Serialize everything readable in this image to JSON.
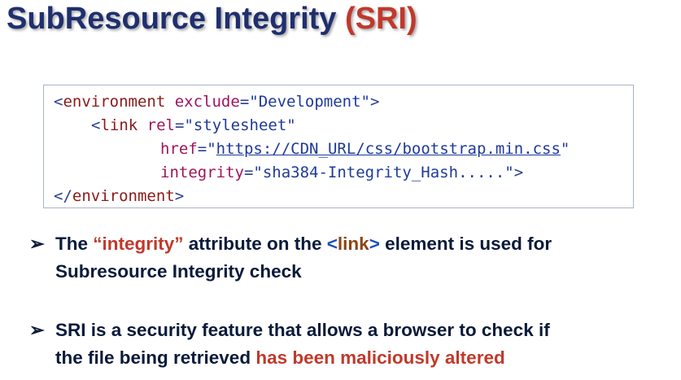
{
  "title": {
    "main": "SubResource Integrity ",
    "accent": "(SRI)"
  },
  "code": {
    "line1": {
      "open": "<",
      "tag": "environment",
      "attr": " exclude",
      "eq": "=",
      "value": "\"Development\"",
      "close": ">"
    },
    "line2": {
      "open": "<",
      "tag": "link",
      "attr": " rel",
      "eq": "=",
      "value": "\"stylesheet\""
    },
    "line3": {
      "attr": "href",
      "eq": "=",
      "quote_open": "\"",
      "url": "https://CDN_URL/css/bootstrap.min.css",
      "quote_close": "\""
    },
    "line4": {
      "attr": "integrity",
      "eq": "=",
      "value": "\"sha384-Integrity_Hash.....\"",
      "close": ">"
    },
    "line5": {
      "open": "</",
      "tag": "environment",
      "close": ">"
    }
  },
  "bullets": {
    "arrow": "➢",
    "b1": {
      "part1": "The ",
      "quoted": "“integrity”",
      "part2": " attribute on the ",
      "lt": "<",
      "tag": "link",
      "gt": ">",
      "part3": " element is used for",
      "line2": "Subresource Integrity check"
    },
    "b2": {
      "line1": "SRI is a security feature that allows a browser to check if",
      "line2a": "the file being retrieved ",
      "line2b": "has been maliciously altered"
    }
  }
}
